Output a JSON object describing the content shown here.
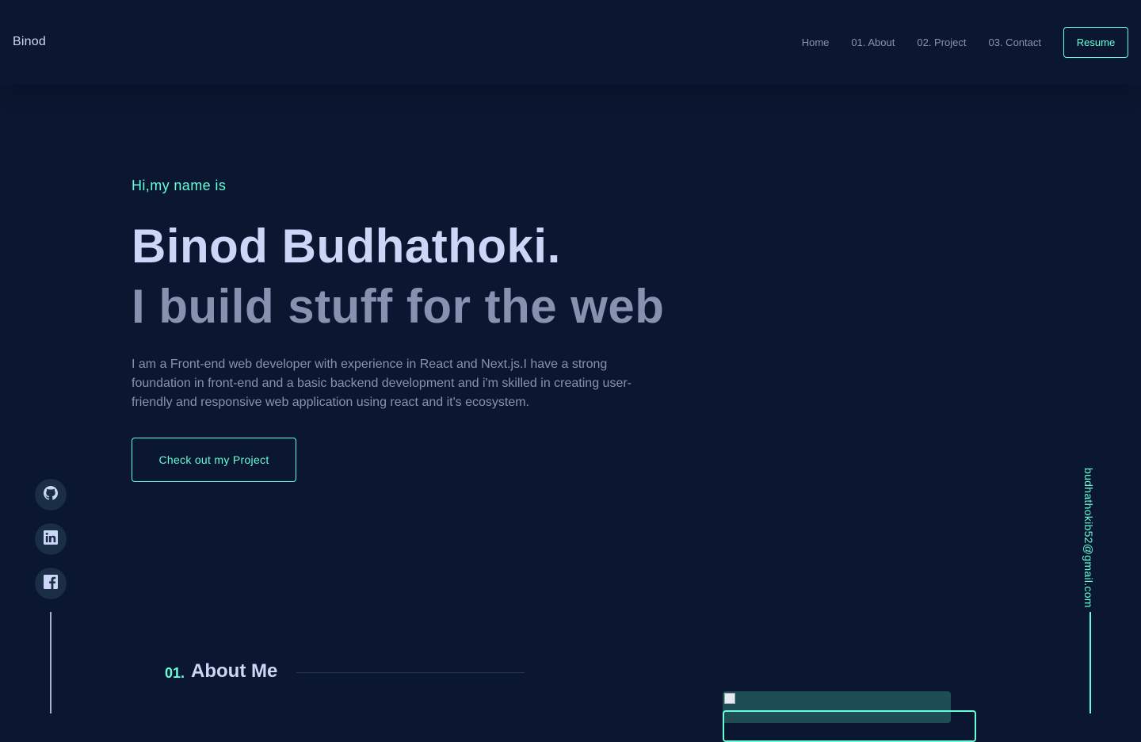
{
  "nav": {
    "brand": "Binod",
    "links": [
      "Home",
      "01. About",
      "02. Project",
      "03. Contact"
    ],
    "resume_label": "Resume"
  },
  "hero": {
    "greeting": "Hi,my name is",
    "name": "Binod Budhathoki.",
    "tagline": "I build stuff for the web",
    "bio": "I am a Front-end web developer with experience in React and Next.js.I have a strong foundation in front-end and a basic backend development and i'm skilled in creating user-friendly and responsive web application using react and it's ecosystem.",
    "cta_label": "Check out my Project"
  },
  "social": {
    "icons": [
      "github-icon",
      "linkedin-icon",
      "facebook-icon"
    ]
  },
  "email": "budhathokib52@gmail.com",
  "about": {
    "number": "01.",
    "title": "About Me"
  },
  "colors": {
    "background": "#0b1730",
    "accent": "#64ffda",
    "heading": "#ccd6f6",
    "text": "#8892b0"
  }
}
